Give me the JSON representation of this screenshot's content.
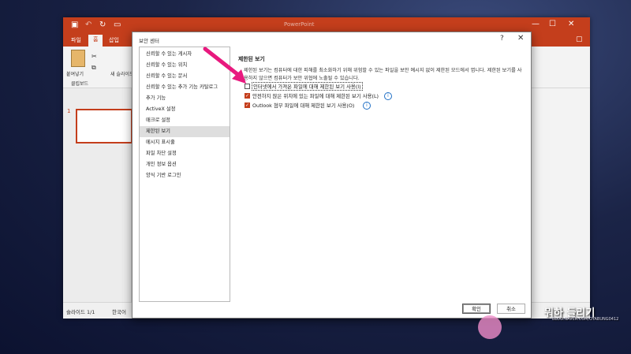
{
  "ppt": {
    "tabs": [
      "파일",
      "홈",
      "삽입"
    ],
    "ribbon": {
      "paste_label": "붙여넣기",
      "new_slide_label": "새 슬라이드",
      "clipboard_group": "클립보드"
    },
    "thumb_number": "1",
    "status": {
      "slide": "슬라이드 1/1",
      "lang": "한국어"
    },
    "titlebar_text": "PowerPoint"
  },
  "dialog": {
    "title": "보안 센터",
    "help": "?",
    "close": "✕",
    "nav": [
      "신뢰할 수 있는 게시자",
      "신뢰할 수 있는 위치",
      "신뢰할 수 있는 문서",
      "신뢰할 수 있는 추가 기능 카탈로그",
      "추가 기능",
      "ActiveX 설정",
      "매크로 설정",
      "제한된 보기",
      "메시지 표시줄",
      "파일 차단 설정",
      "개인 정보 옵션",
      "양식 기반 로그인"
    ],
    "selected_index": 7,
    "section_title": "제한된 보기",
    "description": "제한된 보기는 컴퓨터에 대한 피해를 최소화하기 위해 위험할 수 있는 파일을 보안 예시지 없이 제한된 모드에서 엽니다. 제한된 보기를 사용하지 않으면 컴퓨터가 보안 위협에 노출될 수 있습니다.",
    "options": [
      {
        "label": "인터넷에서 가져온 파일에 대해 제한된 보기 사용(I)",
        "checked": false,
        "info": false
      },
      {
        "label": "안전하지 않은 위치에 있는 파일에 대해 제한된 보기 사용(L)",
        "checked": true,
        "info": true
      },
      {
        "label": "Outlook 첨부 파일에 대해 제한된 보기 사용(O)",
        "checked": true,
        "info": true
      }
    ],
    "ok_label": "확인",
    "cancel_label": "취소"
  },
  "watermark": {
    "text": "뭐하 들리기",
    "sub": "BLOG.NAVER.COM/OYABUNG0412"
  },
  "colors": {
    "accent": "#c43e1c",
    "arrow": "#e8197e"
  }
}
